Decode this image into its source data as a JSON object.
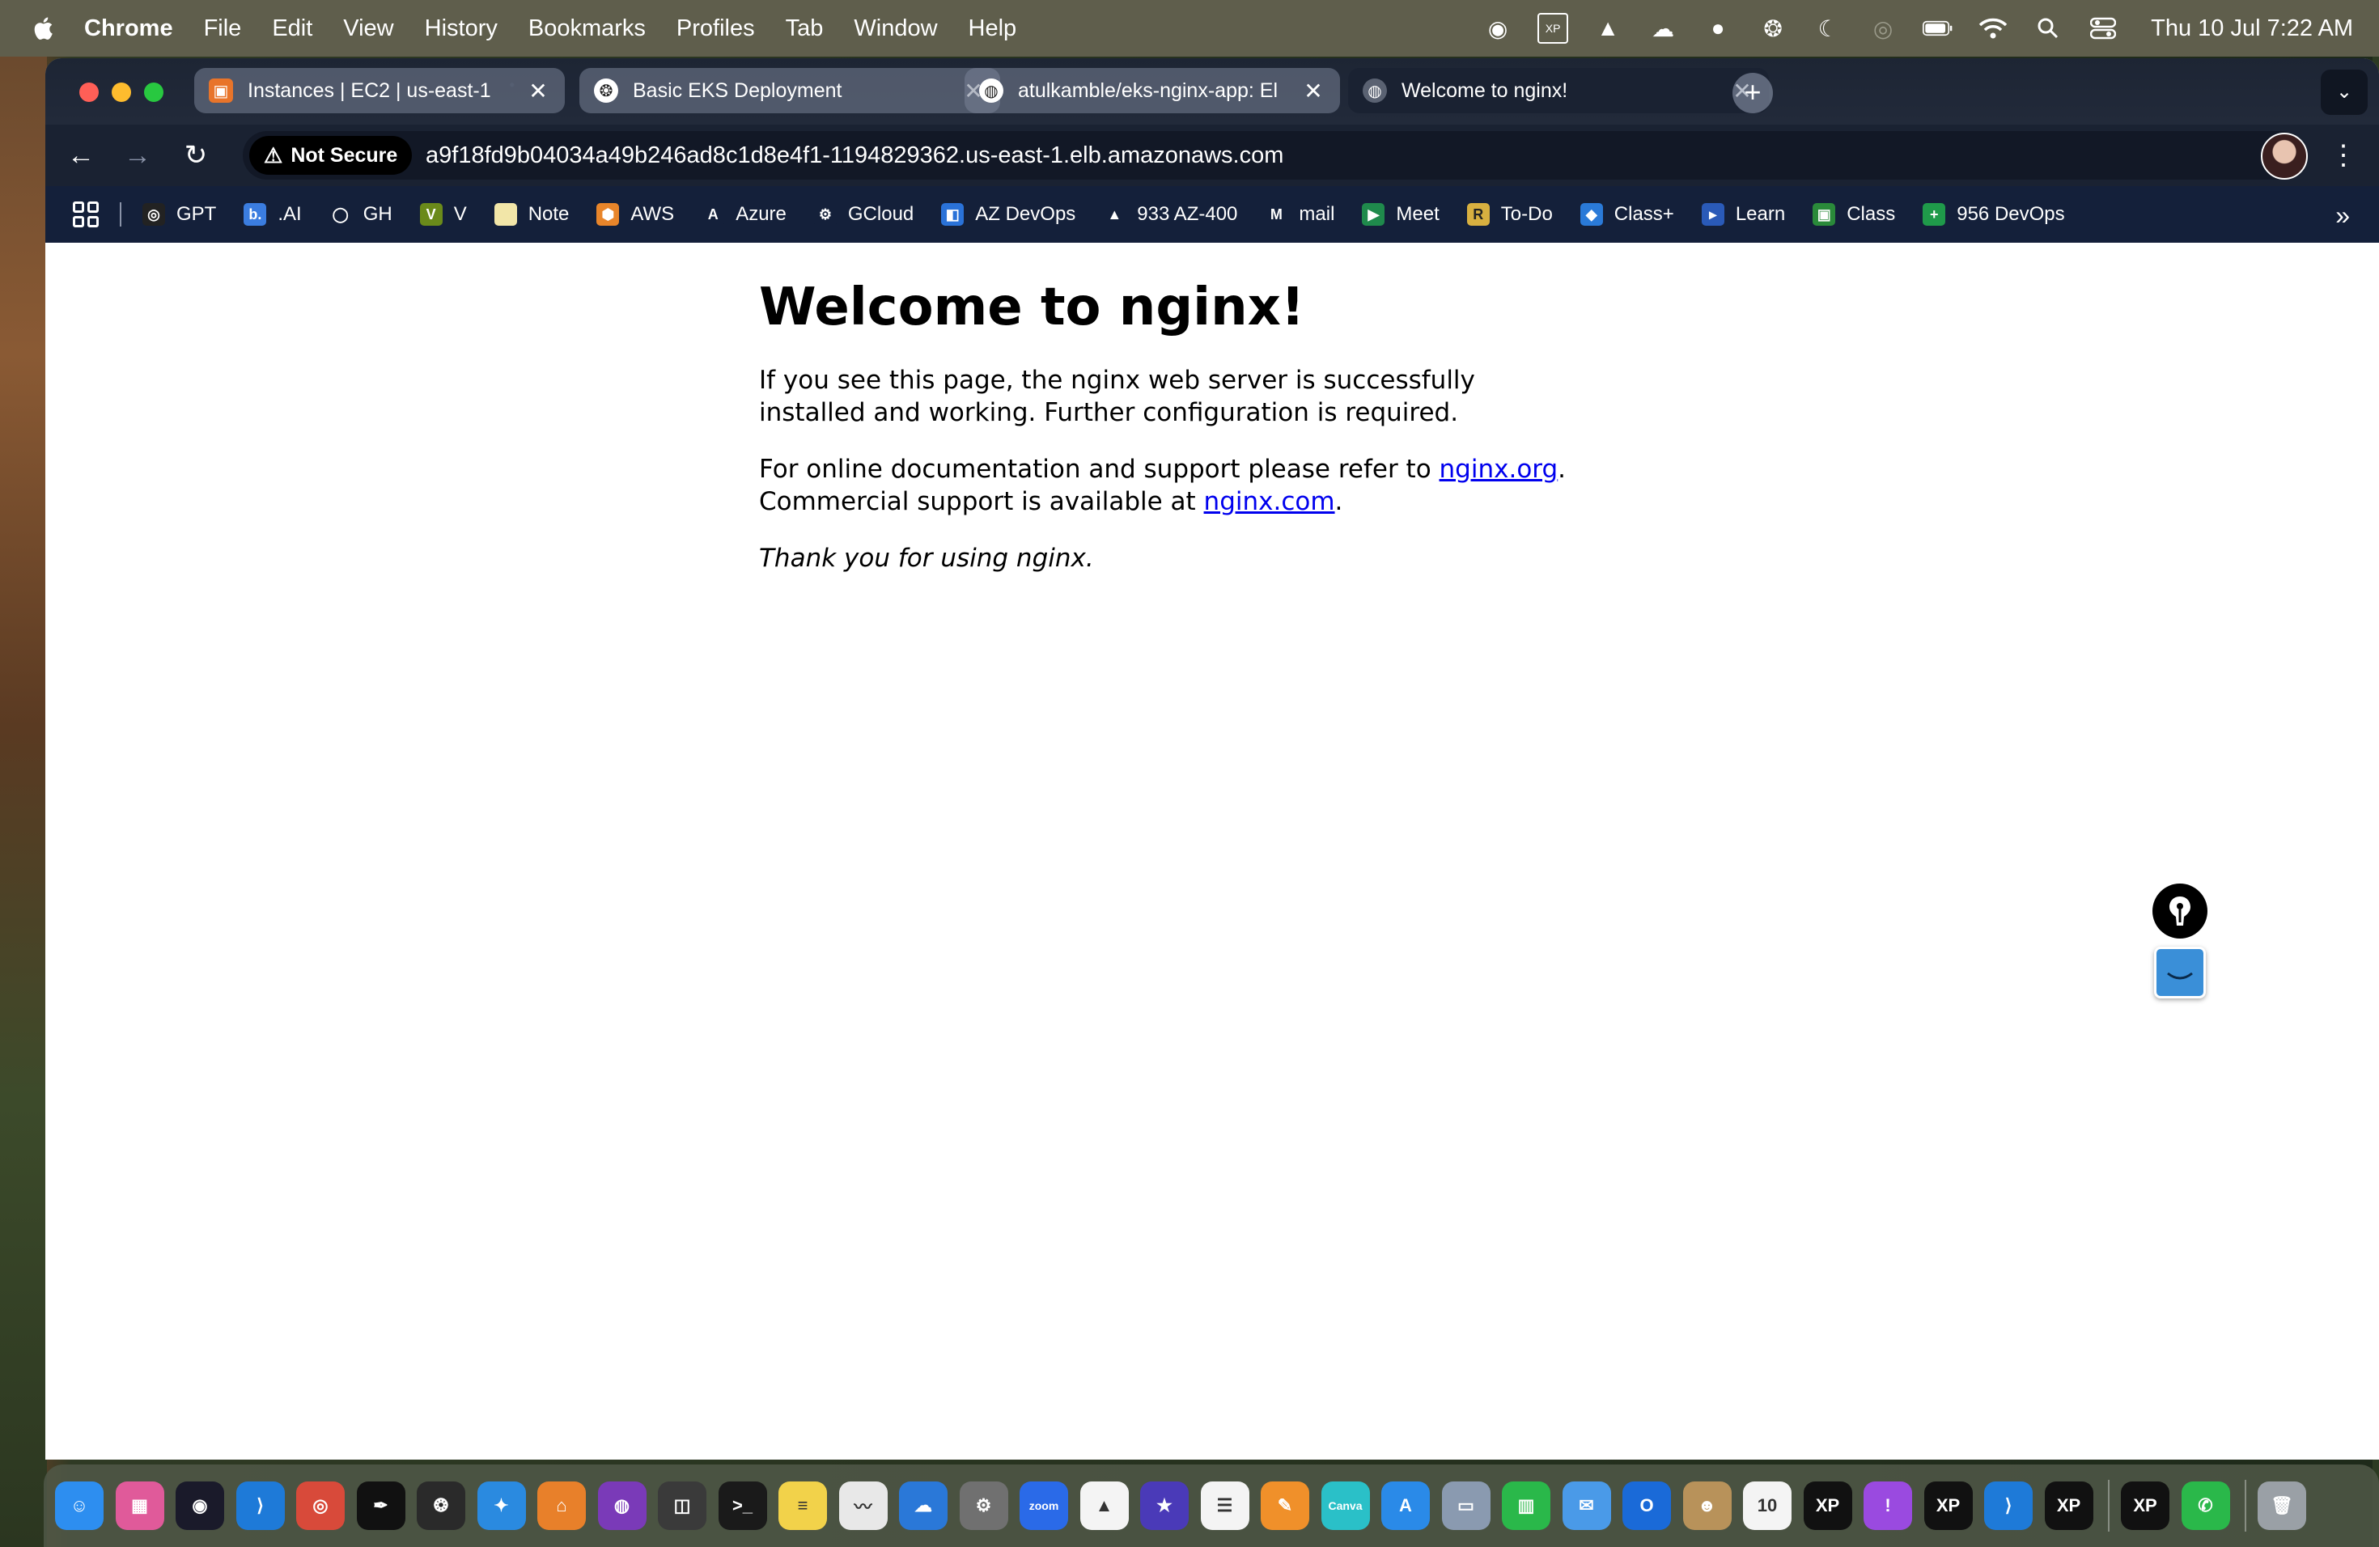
{
  "menubar": {
    "app_name": "Chrome",
    "items": [
      "File",
      "Edit",
      "View",
      "History",
      "Bookmarks",
      "Profiles",
      "Tab",
      "Window",
      "Help"
    ],
    "clock": "Thu 10 Jul  7:22 AM"
  },
  "tabs": [
    {
      "title": "Instances | EC2 | us-east-1",
      "favicon": "aws-ec2-icon",
      "color": "#e8742a"
    },
    {
      "title": "Basic EKS Deployment",
      "favicon": "chatgpt-icon",
      "color": "#222222"
    },
    {
      "title": "atulkamble/eks-nginx-app: El",
      "favicon": "github-icon",
      "color": "#222222"
    },
    {
      "title": "Welcome to nginx!",
      "favicon": "globe-icon",
      "color": "#5a6272"
    }
  ],
  "address_bar": {
    "security_label": "Not Secure",
    "url": "a9f18fd9b04034a49b246ad8c1d8e4f1-1194829362.us-east-1.elb.amazonaws.com"
  },
  "bookmarks": [
    {
      "label": "GPT",
      "icon": "chatgpt-icon",
      "color": "#222222",
      "glyph": "◎"
    },
    {
      "label": ".AI",
      "icon": "b-ai-icon",
      "color": "#3b7de0",
      "glyph": "b."
    },
    {
      "label": "GH",
      "icon": "github-icon",
      "color": "#14203a",
      "glyph": "◯"
    },
    {
      "label": "V",
      "icon": "v-icon",
      "color": "#6a8a1a",
      "glyph": "V"
    },
    {
      "label": "Note",
      "icon": "notes-icon",
      "color": "#f2e6a8",
      "glyph": ""
    },
    {
      "label": "AWS",
      "icon": "aws-cube-icon",
      "color": "#e8852a",
      "glyph": "⬢"
    },
    {
      "label": "Azure",
      "icon": "azure-icon",
      "color": "#14203a",
      "glyph": "A"
    },
    {
      "label": "GCloud",
      "icon": "gcloud-icon",
      "color": "#14203a",
      "glyph": "⚙"
    },
    {
      "label": "AZ DevOps",
      "icon": "azure-devops-icon",
      "color": "#2a72d8",
      "glyph": "◧"
    },
    {
      "label": "933 AZ-400",
      "icon": "google-drive-icon",
      "color": "#14203a",
      "glyph": "▲"
    },
    {
      "label": "mail",
      "icon": "gmail-icon",
      "color": "#14203a",
      "glyph": "M"
    },
    {
      "label": "Meet",
      "icon": "google-meet-icon",
      "color": "#1f8a4c",
      "glyph": "▶"
    },
    {
      "label": "To-Do",
      "icon": "r-todo-icon",
      "color": "#d8b040",
      "glyph": "R"
    },
    {
      "label": "Class+",
      "icon": "classplus-icon",
      "color": "#2a7ad8",
      "glyph": "◆"
    },
    {
      "label": "Learn",
      "icon": "learn-icon",
      "color": "#2a5ab8",
      "glyph": "▸"
    },
    {
      "label": "Class",
      "icon": "google-classroom-icon",
      "color": "#2a8a3a",
      "glyph": "▣"
    },
    {
      "label": "956 DevOps",
      "icon": "plus-sheet-icon",
      "color": "#1f9a4a",
      "glyph": "+"
    }
  ],
  "page": {
    "heading": "Welcome to nginx!",
    "para1": "If you see this page, the nginx web server is successfully installed and working. Further configuration is required.",
    "para2_prefix": "For online documentation and support please refer to ",
    "link1": "nginx.org",
    "para2_mid": ". Commercial support is available at ",
    "link2": "nginx.com",
    "para2_suffix": ".",
    "thanks": "Thank you for using nginx."
  },
  "dock": [
    {
      "name": "finder-icon",
      "color": "#2d8ef0",
      "glyph": "☺"
    },
    {
      "name": "launchpad-icon",
      "color": "#e05a9a",
      "glyph": "▦"
    },
    {
      "name": "obs-icon",
      "color": "#1a1a2a",
      "glyph": "◉"
    },
    {
      "name": "vscode-icon",
      "color": "#1e7ad8",
      "glyph": "⟩"
    },
    {
      "name": "chrome-icon",
      "color": "#d84a3a",
      "glyph": "◎"
    },
    {
      "name": "pen-pin-icon",
      "color": "#111111",
      "glyph": "✒"
    },
    {
      "name": "chatgpt-icon",
      "color": "#2a2a2a",
      "glyph": "❂"
    },
    {
      "name": "safari-icon",
      "color": "#2a8ae0",
      "glyph": "✦"
    },
    {
      "name": "sourcetree-icon",
      "color": "#e8802a",
      "glyph": "⌂"
    },
    {
      "name": "github-desktop-icon",
      "color": "#7a3ab8",
      "glyph": "◍"
    },
    {
      "name": "screenshot-icon",
      "color": "#3a3a3a",
      "glyph": "◫"
    },
    {
      "name": "terminal-icon",
      "color": "#1a1a1a",
      "glyph": ">_"
    },
    {
      "name": "notes-icon",
      "color": "#f2d24a",
      "glyph": "≡"
    },
    {
      "name": "freeform-icon",
      "color": "#e8e8e8",
      "glyph": "〰"
    },
    {
      "name": "onedrive-icon",
      "color": "#2a78d8",
      "glyph": "☁"
    },
    {
      "name": "system-settings-icon",
      "color": "#707070",
      "glyph": "⚙"
    },
    {
      "name": "zoom-icon",
      "color": "#2a6ae8",
      "glyph": "zoom"
    },
    {
      "name": "google-drive-icon",
      "color": "#f4f4f4",
      "glyph": "▲"
    },
    {
      "name": "imovie-icon",
      "color": "#4a3ab8",
      "glyph": "★"
    },
    {
      "name": "reminders-icon",
      "color": "#f4f4f4",
      "glyph": "☰"
    },
    {
      "name": "pages-icon",
      "color": "#f0902a",
      "glyph": "✎"
    },
    {
      "name": "canva-icon",
      "color": "#2ac0c8",
      "glyph": "Canva"
    },
    {
      "name": "app-store-icon",
      "color": "#2a8ae8",
      "glyph": "A"
    },
    {
      "name": "preview-icon",
      "color": "#8a9ab0",
      "glyph": "▭"
    },
    {
      "name": "numbers-icon",
      "color": "#2ab84a",
      "glyph": "▥"
    },
    {
      "name": "mail-icon",
      "color": "#4a9ae8",
      "glyph": "✉"
    },
    {
      "name": "outlook-icon",
      "color": "#1a6ad8",
      "glyph": "O"
    },
    {
      "name": "contacts-icon",
      "color": "#b8925a",
      "glyph": "☻"
    },
    {
      "name": "calendar-icon",
      "color": "#f4f4f4",
      "glyph": "10"
    },
    {
      "name": "xppen-icon",
      "color": "#111111",
      "glyph": "XP"
    },
    {
      "name": "feedback-icon",
      "color": "#9a4ae0",
      "glyph": "!"
    },
    {
      "name": "xppen-icon",
      "color": "#111111",
      "glyph": "XP"
    },
    {
      "name": "vscode-icon",
      "color": "#1e7ad8",
      "glyph": "⟩"
    },
    {
      "name": "xppen-icon",
      "color": "#111111",
      "glyph": "XP"
    },
    {
      "name": "xppen-icon",
      "color": "#111111",
      "glyph": "XP"
    },
    {
      "name": "whatsapp-icon",
      "color": "#2ab84a",
      "glyph": "✆"
    },
    {
      "name": "trash-icon",
      "color": "#9aa0a6",
      "glyph": "🗑"
    }
  ]
}
